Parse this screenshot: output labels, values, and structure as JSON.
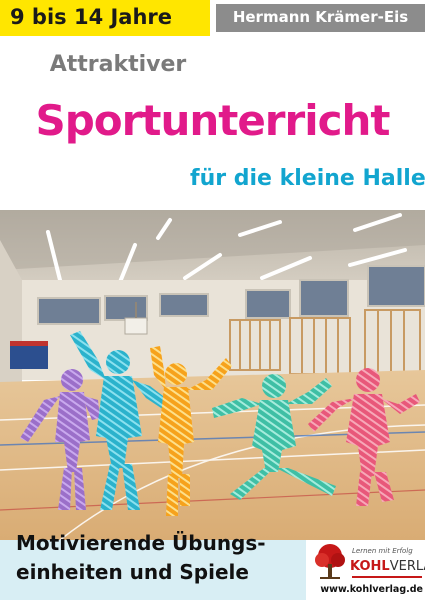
{
  "header": {
    "age_range": "9 bis 14 Jahre",
    "author": "Hermann Krämer-Eis"
  },
  "title": {
    "pre": "Attraktiver",
    "main": "Sportunterricht",
    "sub": "für die kleine Halle"
  },
  "tagline": {
    "line1": "Motivierende Übungs-",
    "line2": "einheiten und Spiele"
  },
  "publisher": {
    "slogan": "Lernen mit Erfolg",
    "name_part1": "KOHL",
    "name_part2": "VERLAG",
    "url": "www.kohlverlag.de"
  },
  "colors": {
    "age_badge": "#ffe600",
    "author_bar": "#8c8c8c",
    "title_main": "#e11a8a",
    "title_sub": "#12a5cf",
    "title_pre": "#7a7a7a",
    "bottom_band": "#d8eef4",
    "publisher_red": "#c61818"
  },
  "illustration": {
    "subject": "gym-hall-with-jumping-children",
    "figure_colors": [
      "#9b6fc9",
      "#2bb2cc",
      "#f6a21c",
      "#4fcfb0",
      "#e8587a"
    ]
  }
}
